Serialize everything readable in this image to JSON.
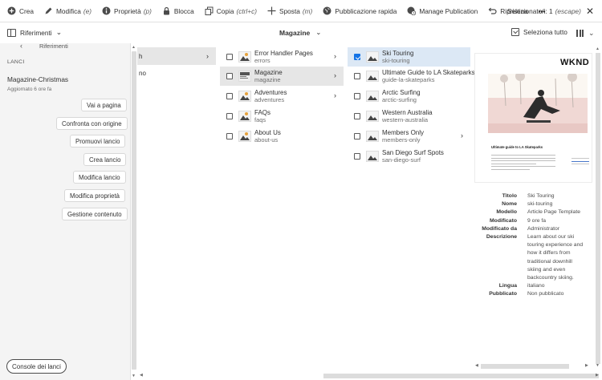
{
  "actionbar": {
    "create": "Crea",
    "edit": "Modifica",
    "edit_shortcut": "(e)",
    "properties": "Proprietà",
    "properties_shortcut": "(p)",
    "lock": "Blocca",
    "copy": "Copia",
    "copy_shortcut": "(ctrl+c)",
    "move": "Sposta",
    "move_shortcut": "(m)",
    "quick_publish": "Pubblicazione rapida",
    "manage_publication": "Manage Publication",
    "restore": "Ripristina",
    "more": "•••",
    "selection": "Selezionato/i: 1",
    "selection_shortcut": "(escape)"
  },
  "toolbar": {
    "rail_label": "Riferimenti",
    "title": "Magazine",
    "select_all": "Seleziona tutto"
  },
  "rail": {
    "header": "Riferimenti",
    "section": "LANCI",
    "launch_name": "Magazine-Christmas",
    "launch_meta": "Aggiornato 6 ore fa",
    "buttons": {
      "go_to_page": "Vai a pagina",
      "compare": "Confronta con origine",
      "promote": "Promuovi lancio",
      "create": "Crea lancio",
      "edit": "Modifica lancio",
      "edit_props": "Modifica proprietà",
      "manage_content": "Gestione contenuto"
    },
    "console": "Console dei lanci"
  },
  "col1": {
    "row1": "h",
    "row2": "no"
  },
  "col2": [
    {
      "title": "Error Handler Pages",
      "name": "errors"
    },
    {
      "title": "Magazine",
      "name": "magazine"
    },
    {
      "title": "Adventures",
      "name": "adventures"
    },
    {
      "title": "FAQs",
      "name": "faqs"
    },
    {
      "title": "About Us",
      "name": "about-us"
    }
  ],
  "col3": [
    {
      "title": "Ski Touring",
      "name": "ski-touring"
    },
    {
      "title": "Ultimate Guide to LA Skateparks",
      "name": "guide-la-skateparks"
    },
    {
      "title": "Arctic Surfing",
      "name": "arctic-surfing"
    },
    {
      "title": "Western Australia",
      "name": "western-australia"
    },
    {
      "title": "Members Only",
      "name": "members-only"
    },
    {
      "title": "San Diego Surf Spots",
      "name": "san-diego-surf"
    }
  ],
  "preview": {
    "logo": "WKND S",
    "headline": "Ultimate guide to LA Skateparks"
  },
  "properties": [
    {
      "k": "Titolo",
      "v": "Ski Touring"
    },
    {
      "k": "Nome",
      "v": "ski-touring"
    },
    {
      "k": "Modello",
      "v": "Article Page Template"
    },
    {
      "k": "Modificato",
      "v": "9 ore fa"
    },
    {
      "k": "Modificato da",
      "v": "Administrator"
    },
    {
      "k": "Descrizione",
      "v": "Learn about our ski touring experience and how it differs from traditional downhill skiing and even backcountry skiing."
    },
    {
      "k": "Lingua",
      "v": "italiano"
    },
    {
      "k": "Pubblicato",
      "v": "Non pubblicato"
    }
  ],
  "colors": {
    "accent": "#1473e6",
    "selected_bg": "#dce8f5",
    "active_bg": "#e6e6e6"
  }
}
